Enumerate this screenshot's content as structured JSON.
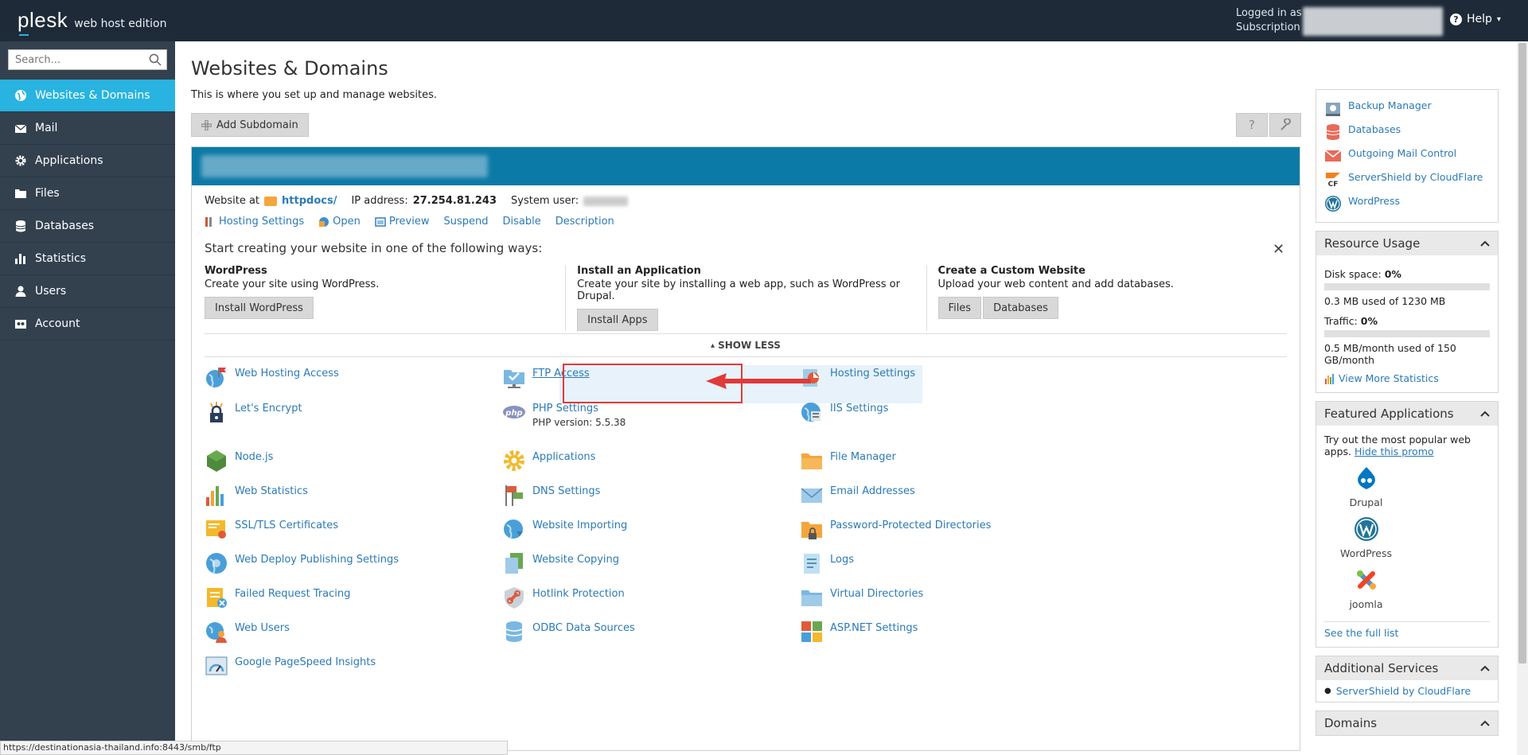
{
  "topbar": {
    "logo": "plesk",
    "edition": "web host edition",
    "logged_in_line1": "Logged in as",
    "logged_in_line2": "Subscription",
    "help_label": "Help",
    "help_caret": "▾"
  },
  "sidebar": {
    "search_placeholder": "Search...",
    "items": [
      {
        "label": "Websites & Domains",
        "icon": "globe-icon"
      },
      {
        "label": "Mail",
        "icon": "envelope-icon"
      },
      {
        "label": "Applications",
        "icon": "gear-icon"
      },
      {
        "label": "Files",
        "icon": "folder-icon"
      },
      {
        "label": "Databases",
        "icon": "database-icon"
      },
      {
        "label": "Statistics",
        "icon": "bar-chart-icon"
      },
      {
        "label": "Users",
        "icon": "user-icon"
      },
      {
        "label": "Account",
        "icon": "account-icon"
      }
    ]
  },
  "main": {
    "title": "Websites & Domains",
    "description": "This is where you set up and manage websites.",
    "add_subdomain": "Add Subdomain",
    "help_glyph": "?",
    "domain": {
      "website_at": "Website at",
      "docroot": "httpdocs/",
      "ip_label": "IP address:",
      "ip_value": "27.254.81.243",
      "sysuser_label": "System user:",
      "actions": [
        "Hosting Settings",
        "Open",
        "Preview",
        "Suspend",
        "Disable",
        "Description"
      ]
    },
    "start": {
      "title": "Start creating your website in one of the following ways:",
      "close": "✕",
      "cols": [
        {
          "heading": "WordPress",
          "text": "Create your site using WordPress.",
          "buttons": [
            "Install WordPress"
          ]
        },
        {
          "heading": "Install an Application",
          "text": "Create your site by installing a web app, such as WordPress or Drupal.",
          "buttons": [
            "Install Apps"
          ]
        },
        {
          "heading": "Create a Custom Website",
          "text": "Upload your web content and add databases.",
          "buttons": [
            "Files",
            "Databases"
          ]
        }
      ],
      "show_less": "SHOW LESS",
      "show_less_caret": "▴"
    },
    "tools": [
      {
        "label": "Web Hosting Access",
        "icon": "globe-flag-icon"
      },
      {
        "label": "FTP Access",
        "icon": "ftp-folder-icon"
      },
      {
        "label": "Hosting Settings",
        "icon": "hosting-settings-icon"
      },
      {
        "label": "Let's Encrypt",
        "icon": "lock-icon"
      },
      {
        "label": "PHP Settings",
        "icon": "php-icon",
        "sub": "PHP version: 5.5.38"
      },
      {
        "label": "IIS Settings",
        "icon": "iis-icon"
      },
      {
        "label": "Node.js",
        "icon": "nodejs-icon"
      },
      {
        "label": "Applications",
        "icon": "applications-gear-icon"
      },
      {
        "label": "File Manager",
        "icon": "file-manager-icon"
      },
      {
        "label": "Web Statistics",
        "icon": "statistics-icon"
      },
      {
        "label": "DNS Settings",
        "icon": "dns-icon"
      },
      {
        "label": "Email Addresses",
        "icon": "email-icon"
      },
      {
        "label": "SSL/TLS Certificates",
        "icon": "certificate-icon"
      },
      {
        "label": "Website Importing",
        "icon": "import-icon"
      },
      {
        "label": "Password-Protected Directories",
        "icon": "protected-dir-icon"
      },
      {
        "label": "Web Deploy Publishing Settings",
        "icon": "web-deploy-icon"
      },
      {
        "label": "Website Copying",
        "icon": "copy-icon"
      },
      {
        "label": "Logs",
        "icon": "logs-icon"
      },
      {
        "label": "Failed Request Tracing",
        "icon": "tracing-icon"
      },
      {
        "label": "Hotlink Protection",
        "icon": "hotlink-icon"
      },
      {
        "label": "Virtual Directories",
        "icon": "virtual-dir-icon"
      },
      {
        "label": "Web Users",
        "icon": "web-users-icon"
      },
      {
        "label": "ODBC Data Sources",
        "icon": "odbc-icon"
      },
      {
        "label": "ASP.NET Settings",
        "icon": "aspnet-icon"
      },
      {
        "label": "Google PageSpeed Insights",
        "icon": "pagespeed-icon"
      }
    ]
  },
  "right": {
    "quick_links": [
      {
        "label": "Backup Manager",
        "icon": "backup-icon"
      },
      {
        "label": "Databases",
        "icon": "database-icon"
      },
      {
        "label": "Outgoing Mail Control",
        "icon": "mail-control-icon"
      },
      {
        "label": "ServerShield by CloudFlare",
        "icon": "cloudflare-icon"
      },
      {
        "label": "WordPress",
        "icon": "wordpress-icon"
      }
    ],
    "resource": {
      "title": "Resource Usage",
      "disk_label": "Disk space:",
      "disk_pct": "0%",
      "disk_used": "0.3 MB used of 1230 MB",
      "traffic_label": "Traffic:",
      "traffic_pct": "0%",
      "traffic_used": "0.5 MB/month used of 150 GB/month",
      "view_more": "View More Statistics"
    },
    "featured": {
      "title": "Featured Applications",
      "text": "Try out the most popular web apps.",
      "hide": "Hide this promo",
      "apps": [
        "Drupal",
        "WordPress",
        "joomla"
      ],
      "full_list": "See the full list"
    },
    "additional": {
      "title": "Additional Services",
      "items": [
        "ServerShield by CloudFlare"
      ]
    },
    "domains": {
      "title": "Domains"
    }
  },
  "statusbar": "https://destinationasia-thailand.info:8443/smb/ftp"
}
